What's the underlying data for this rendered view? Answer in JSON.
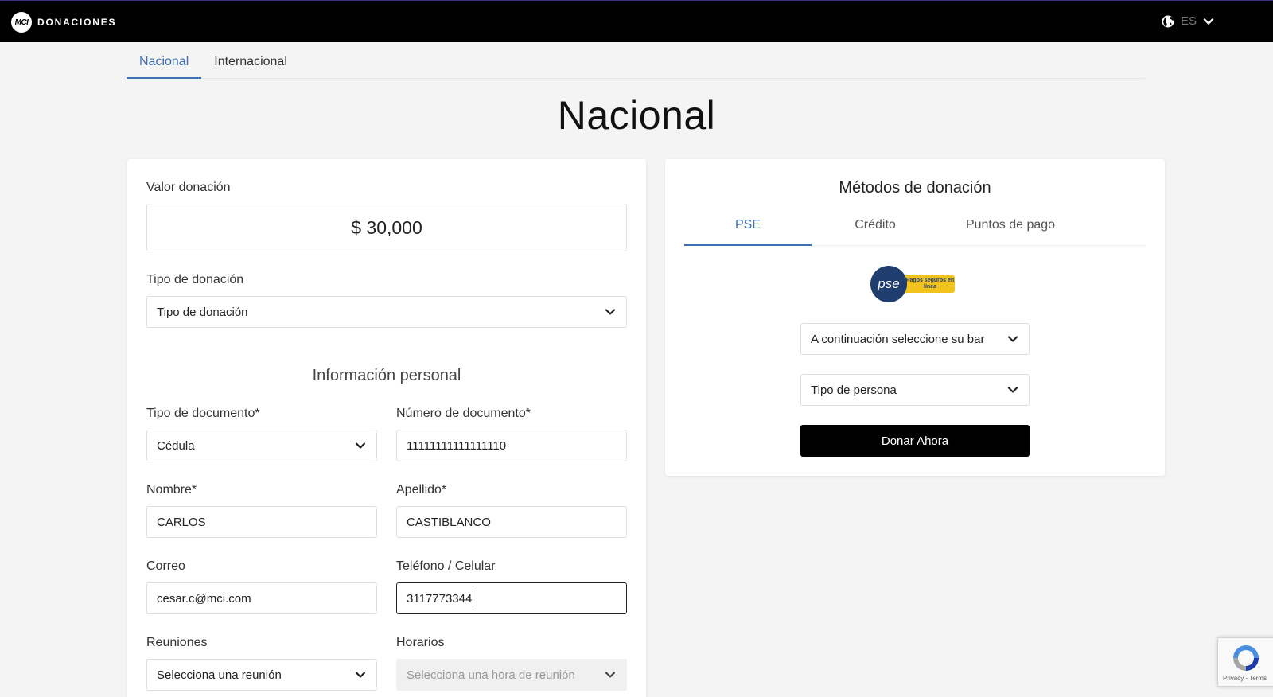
{
  "header": {
    "logo_mark": "MCI",
    "app_name": "DONACIONES",
    "language": "ES"
  },
  "top_tabs": [
    {
      "label": "Nacional",
      "active": true
    },
    {
      "label": "Internacional",
      "active": false
    }
  ],
  "page_title": "Nacional",
  "donation_form": {
    "amount_label": "Valor donación",
    "amount_value": "$ 30,000",
    "type_label": "Tipo de donación",
    "type_value": "Tipo de donación",
    "personal_section_title": "Información personal",
    "doc_type_label": "Tipo de documento*",
    "doc_type_value": "Cédula",
    "doc_number_label": "Número de documento*",
    "doc_number_value": "11111111111111110",
    "first_name_label": "Nombre*",
    "first_name_value": "CARLOS",
    "last_name_label": "Apellido*",
    "last_name_value": "CASTIBLANCO",
    "email_label": "Correo",
    "email_value": "cesar.c@mci.com",
    "phone_label": "Teléfono / Celular",
    "phone_value": "3117773344",
    "meetings_label": "Reuniones",
    "meetings_value": "Selecciona una reunión",
    "schedule_label": "Horarios",
    "schedule_value": "Selecciona una hora de reunión"
  },
  "methods": {
    "title": "Métodos de donación",
    "tabs": [
      {
        "label": "PSE",
        "active": true
      },
      {
        "label": "Crédito",
        "active": false
      },
      {
        "label": "Puntos de pago",
        "active": false
      }
    ],
    "pse_logo_text": "pse",
    "pse_tagline": "Pagos seguros en línea",
    "bank_select_value": "A continuación seleccione su bar",
    "person_type_value": "Tipo de persona",
    "donate_button": "Donar Ahora"
  },
  "recaptcha": {
    "text": "Privacy - Terms"
  },
  "colors": {
    "accent": "#3f6fb5",
    "topbar": "#000000",
    "background": "#f4f4f4",
    "pse_blue": "#1f3d6e",
    "pse_yellow": "#f2c31b"
  },
  "icons": [
    "globe-icon",
    "chevron-down-icon",
    "recaptcha-icon"
  ]
}
